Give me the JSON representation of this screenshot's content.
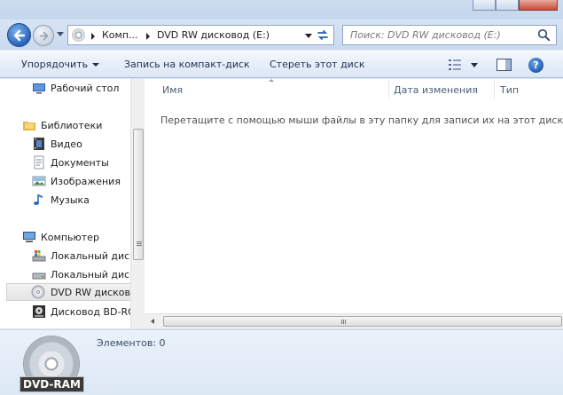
{
  "window": {
    "caption_buttons": [
      "minimize",
      "maximize",
      "close"
    ]
  },
  "nav": {
    "address_segments": [
      "Комп...",
      "DVD RW дисковод (E:)"
    ],
    "search_placeholder": "Поиск: DVD RW дисковод (E:)"
  },
  "toolbar": {
    "organize_label": "Упорядочить",
    "burn_label": "Запись на компакт-диск",
    "erase_label": "Стереть этот диск"
  },
  "sidebar": {
    "items": [
      {
        "label": "Рабочий стол",
        "icon": "desktop-icon"
      },
      {
        "label": "Библиотеки",
        "icon": "libraries-icon"
      },
      {
        "label": "Видео",
        "icon": "video-icon"
      },
      {
        "label": "Документы",
        "icon": "documents-icon"
      },
      {
        "label": "Изображения",
        "icon": "pictures-icon"
      },
      {
        "label": "Музыка",
        "icon": "music-icon"
      },
      {
        "label": "Компьютер",
        "icon": "computer-icon"
      },
      {
        "label": "Локальный диск",
        "icon": "system-drive-icon"
      },
      {
        "label": "Локальный диск",
        "icon": "drive-icon"
      },
      {
        "label": "DVD RW дисковод",
        "icon": "dvd-drive-icon",
        "selected": true
      },
      {
        "label": "Дисковод BD-RO",
        "icon": "bd-drive-icon"
      }
    ]
  },
  "content": {
    "columns": [
      "Имя",
      "Дата изменения",
      "Тип"
    ],
    "empty_message": "Перетащите с помощью мыши файлы в эту папку для записи их на этот диск."
  },
  "details": {
    "disc_label": "DVD-RAM",
    "item_count": "Элементов: 0"
  },
  "colors": {
    "accent": "#2963b8",
    "window_frame": "#cddcee",
    "command_bar": "#e6eef8"
  }
}
